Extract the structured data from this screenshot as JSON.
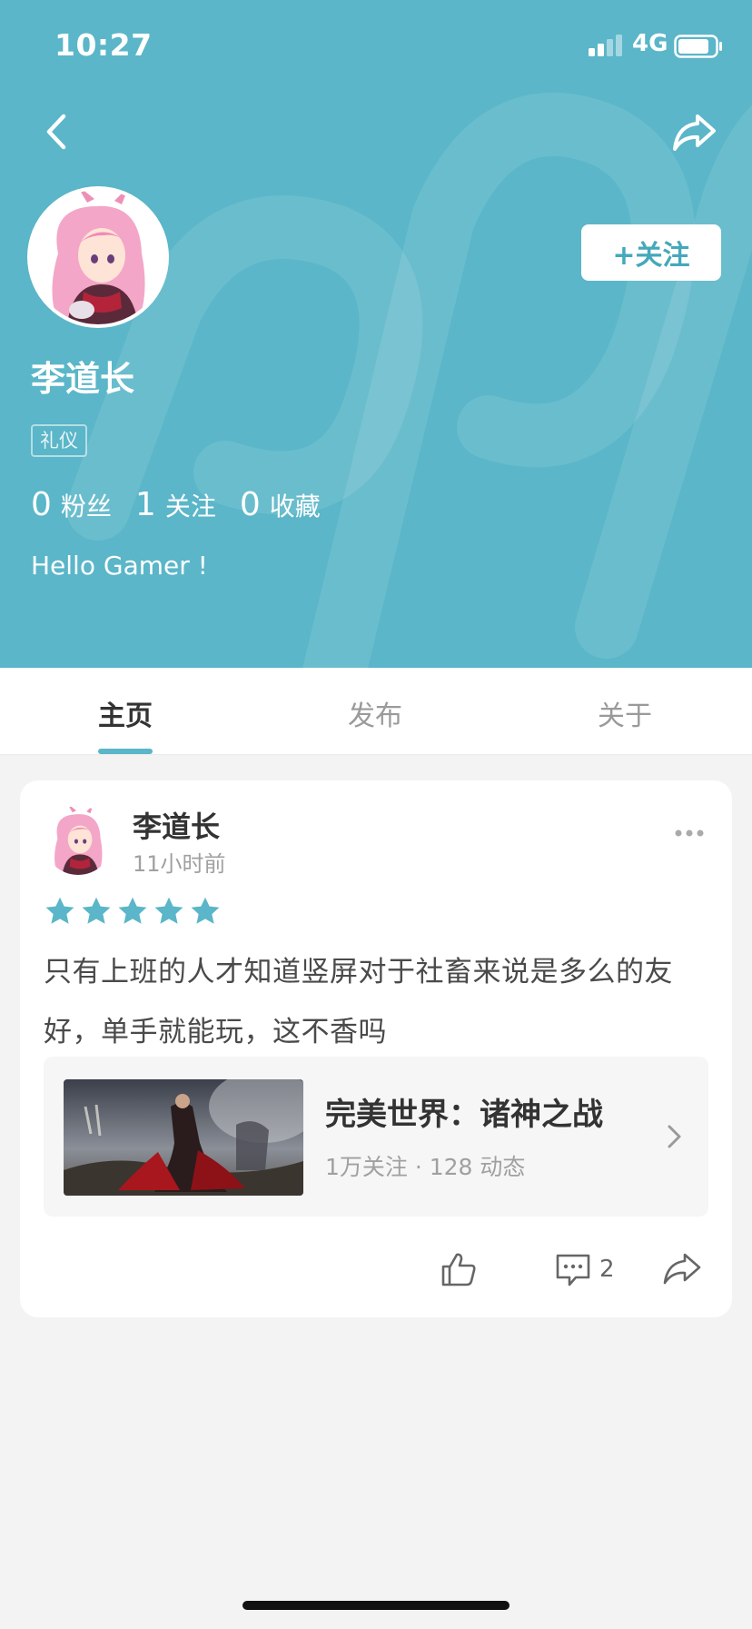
{
  "status_bar": {
    "time": "10:27",
    "network": "4G"
  },
  "header": {
    "bg_color": "#5ab6c8",
    "profile_name": "李道长",
    "tag": "礼仪",
    "follow_label": "+关注",
    "stats": [
      {
        "num": "0",
        "label": "粉丝"
      },
      {
        "num": "1",
        "label": "关注"
      },
      {
        "num": "0",
        "label": "收藏"
      }
    ],
    "bio": "Hello Gamer !"
  },
  "tabs": [
    {
      "label": "主页",
      "active": true
    },
    {
      "label": "发布",
      "active": false
    },
    {
      "label": "关于",
      "active": false
    }
  ],
  "post": {
    "author": "李道长",
    "time": "11小时前",
    "rating": 5,
    "star_color": "#5ab6c8",
    "text": "只有上班的人才知道竖屏对于社畜来说是多么的友好，单手就能玩，这不香吗",
    "game": {
      "title": "完美世界：诸神之战",
      "meta": "1万关注 · 128 动态"
    },
    "comment_count": "2"
  },
  "icons": {
    "back": "chevron-left-icon",
    "share": "share-arrow-icon",
    "more": "ellipsis-icon",
    "like": "thumbs-up-icon",
    "comment": "comment-bubble-icon"
  }
}
